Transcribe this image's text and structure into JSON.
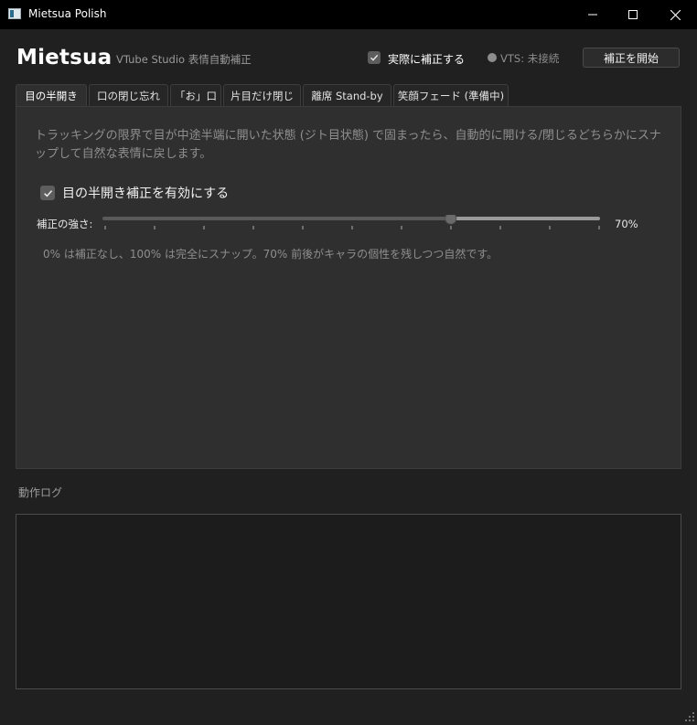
{
  "window": {
    "title": "Mietsua Polish",
    "icon": "app-window-icon",
    "controls": [
      "minimize-icon",
      "maximize-icon",
      "close-icon"
    ]
  },
  "header": {
    "brand": "Mietsua",
    "subtitle": "VTube Studio 表情自動補正",
    "auto_correct_label": "実際に補正する",
    "auto_correct_checked": true,
    "vts_status": "VTS: 未接続",
    "start_button": "補正を開始"
  },
  "tabs": [
    {
      "label": "目の半開き",
      "active": true
    },
    {
      "label": "口の閉じ忘れ",
      "active": false
    },
    {
      "label": "「お」口",
      "active": false
    },
    {
      "label": "片目だけ閉じ",
      "active": false
    },
    {
      "label": "離席 Stand-by",
      "active": false
    },
    {
      "label": "笑顔フェード (準備中)",
      "active": false
    }
  ],
  "panel": {
    "description": "トラッキングの限界で目が中途半端に開いた状態 (ジト目状態) で固まったら、自動的に開ける/閉じるどちらかにスナップして自然な表情に戻します。",
    "enable_label": "目の半開き補正を有効にする",
    "enable_checked": true,
    "strength_label": "補正の強さ:",
    "strength_percent": 70,
    "strength_value_text": "70%",
    "hint": "0% は補正なし、100% は完全にスナップ。70% 前後がキャラの個性を残しつつ自然です。"
  },
  "log": {
    "label": "動作ログ"
  },
  "colors": {
    "background": "#202020",
    "titlebar": "#000000",
    "panel": "#2f2f2f",
    "log_area": "#1c1c1c",
    "slider_fill": "#9a9a9a",
    "slider_track": "#5a5a5a"
  }
}
